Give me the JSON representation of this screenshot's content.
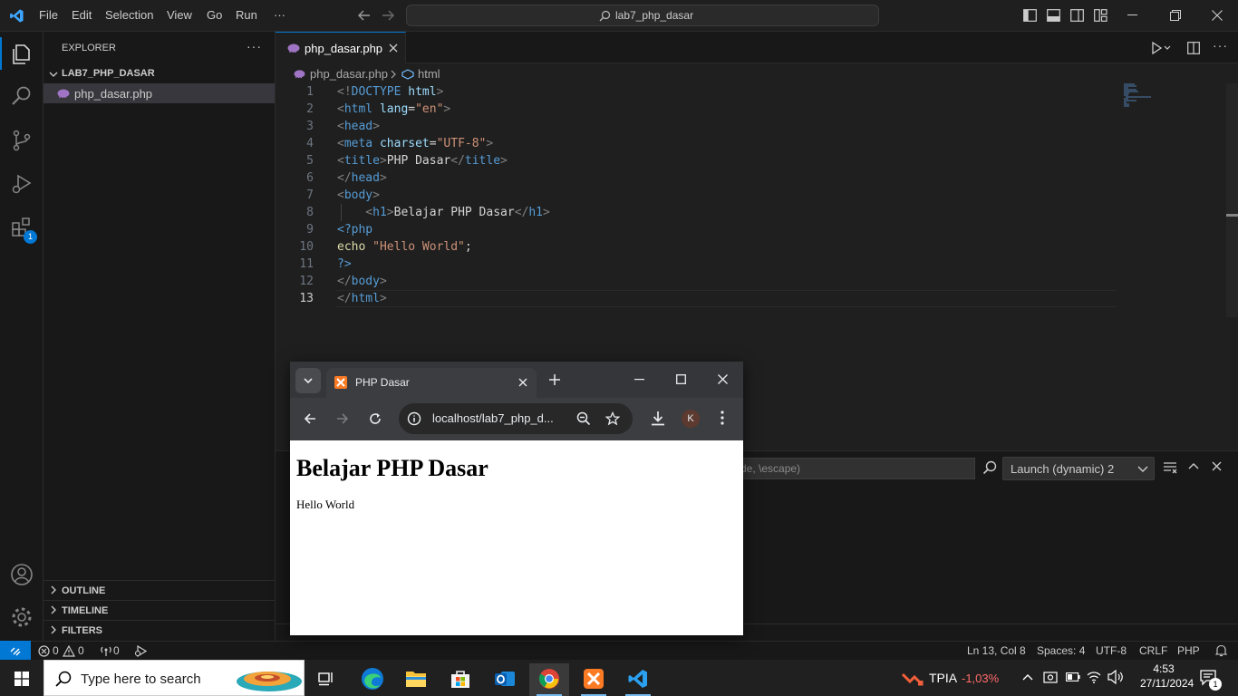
{
  "menu": [
    "File",
    "Edit",
    "Selection",
    "View",
    "Go",
    "Run",
    "···"
  ],
  "command_center": "lab7_php_dasar",
  "explorer": {
    "title": "EXPLORER",
    "folder": "LAB7_PHP_DASAR",
    "files": [
      "php_dasar.php"
    ],
    "sections": [
      "OUTLINE",
      "TIMELINE",
      "FILTERS"
    ]
  },
  "extensions_badge": "1",
  "editor": {
    "tab_label": "php_dasar.php",
    "breadcrumb_file": "php_dasar.php",
    "breadcrumb_symbol": "html",
    "line_numbers": [
      "1",
      "2",
      "3",
      "4",
      "5",
      "6",
      "7",
      "8",
      "9",
      "10",
      "11",
      "12",
      "13"
    ]
  },
  "panel": {
    "filter_placeholder": "de, \\escape)",
    "launch_config": "Launch (dynamic) 2"
  },
  "browser": {
    "tab_title": "PHP Dasar",
    "url": "localhost/lab7_php_d...",
    "profile_initial": "K",
    "page_heading": "Belajar PHP Dasar",
    "page_text": "Hello World"
  },
  "statusbar": {
    "errors": "0",
    "warnings": "0",
    "ports": "0",
    "position": "Ln 13, Col 8",
    "spaces": "Spaces: 4",
    "encoding": "UTF-8",
    "eol": "CRLF",
    "language": "PHP"
  },
  "taskbar": {
    "search_placeholder": "Type here to search",
    "stock_name": "TPIA",
    "stock_change": "-1,03%",
    "time": "4:53",
    "date": "27/11/2024",
    "notification_count": "1"
  },
  "colors": {
    "accent": "#0078d4",
    "editor_bg": "#1f1f1f",
    "sidebar_bg": "#181818",
    "stock_down": "#ff6b6b"
  }
}
